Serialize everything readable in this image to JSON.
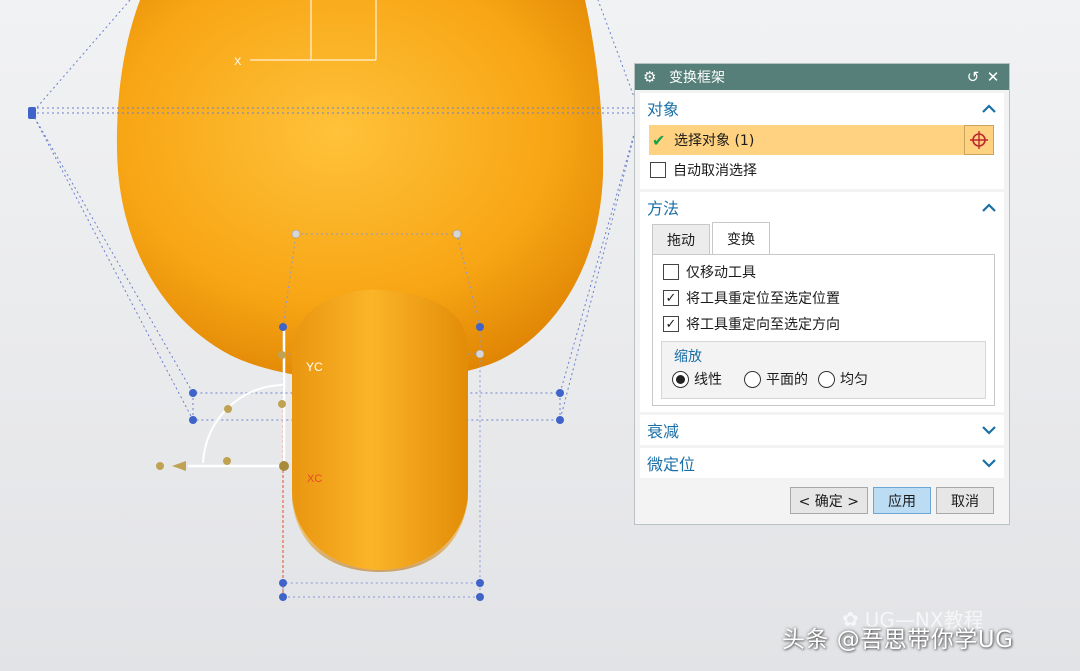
{
  "viewport": {
    "axis_labels": {
      "yc": "YC",
      "xc": "XC",
      "x_top": "X"
    },
    "colors": {
      "body": "#f5a412",
      "handle": "#3f63c8",
      "dashed": "#6b7fcf",
      "axis_x": "#e84a2a"
    }
  },
  "dialog": {
    "title": "变换框架",
    "icons": {
      "title": "gear-icon",
      "reset": "reset-icon",
      "close": "close-icon"
    },
    "object_section": {
      "title": "对象",
      "select_label": "选择对象 (1)",
      "auto_deselect_label": "自动取消选择",
      "auto_deselect_checked": false
    },
    "method_section": {
      "title": "方法",
      "tabs": [
        {
          "label": "拖动",
          "active": false
        },
        {
          "label": "变换",
          "active": true
        }
      ],
      "options": [
        {
          "label": "仅移动工具",
          "checked": false
        },
        {
          "label": "将工具重定位至选定位置",
          "checked": true
        },
        {
          "label": "将工具重定向至选定方向",
          "checked": true
        }
      ],
      "scale_group": {
        "title": "缩放",
        "radios": [
          {
            "label": "线性",
            "selected": true
          },
          {
            "label": "平面的",
            "selected": false
          },
          {
            "label": "均匀",
            "selected": false
          }
        ]
      }
    },
    "falloff_section": {
      "title": "衰减"
    },
    "micro_section": {
      "title": "微定位"
    },
    "buttons": {
      "ok": "< 确定 >",
      "apply": "应用",
      "cancel": "取消"
    }
  },
  "watermark": {
    "text": "头条 @吾思带你学UG",
    "faint": "UG—NX教程"
  }
}
